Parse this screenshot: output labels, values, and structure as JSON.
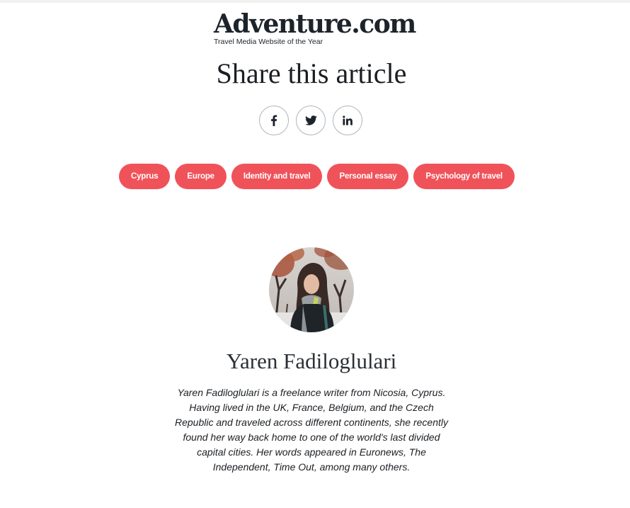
{
  "brand": {
    "name": "Adventure.com",
    "tagline": "Travel Media Website of the Year"
  },
  "share": {
    "heading": "Share this article",
    "buttons": [
      {
        "icon": "facebook-icon",
        "glyph": "f"
      },
      {
        "icon": "twitter-icon"
      },
      {
        "icon": "linkedin-icon",
        "glyph": "in"
      }
    ]
  },
  "tags": [
    {
      "label": "Cyprus"
    },
    {
      "label": "Europe"
    },
    {
      "label": "Identity and travel"
    },
    {
      "label": "Personal essay"
    },
    {
      "label": "Psychology of travel"
    }
  ],
  "author": {
    "name": "Yaren Fadiloglulari",
    "bio": "Yaren Fadiloglulari is a freelance writer from Nicosia, Cyprus. Having lived in the UK, France, Belgium, and the Czech Republic and traveled across different continents, she recently found her way back home to one of the world's last divided capital cities. Her words appeared in Euronews, The Independent, Time Out, among many others."
  },
  "colors": {
    "tag_background": "#f0525a",
    "tag_text": "#ffffff",
    "brand_text": "#1d232a",
    "social_border": "#aeb6bd"
  }
}
